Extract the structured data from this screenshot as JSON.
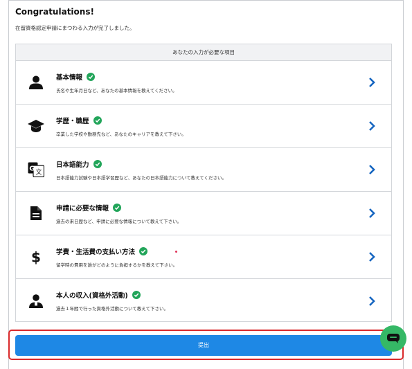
{
  "header": {
    "title": "Congratulations!",
    "subtitle": "在留資格認定申請にまつわる入力が完了しました。"
  },
  "panel": {
    "heading": "あなたの入力が必要な項目",
    "items": [
      {
        "icon": "person-icon",
        "title": "基本情報",
        "desc": "氏名や生年月日など、あなたの基本情報を教えてください。",
        "status": "complete"
      },
      {
        "icon": "graduation-cap-icon",
        "title": "学歴・職歴",
        "desc": "卒業した学校や勤務先など、あなたのキャリアを教えて下さい。",
        "status": "complete"
      },
      {
        "icon": "translate-icon",
        "title": "日本語能力",
        "desc": "日本語能力試験や日本語学習歴など、あなたの日本語能力について教えてください。",
        "status": "complete"
      },
      {
        "icon": "document-icon",
        "title": "申請に必要な情報",
        "desc": "過去の来日歴など、申請に必要な情報について教えて下さい。",
        "status": "complete"
      },
      {
        "icon": "dollar-icon",
        "title": "学費・生活費の支払い方法",
        "desc": "留学時の費用を誰がどのように負担するかを教えて下さい。",
        "status": "complete"
      },
      {
        "icon": "person-work-icon",
        "title": "本人の収入(資格外活動)",
        "desc": "過去１年間で行った資格外活動について教えて下さい。",
        "status": "complete"
      }
    ]
  },
  "submit": {
    "label": "提出"
  },
  "colors": {
    "accent": "#1e88e5",
    "success": "#22a55a",
    "highlight": "#d9292b",
    "chat": "#35b866"
  }
}
